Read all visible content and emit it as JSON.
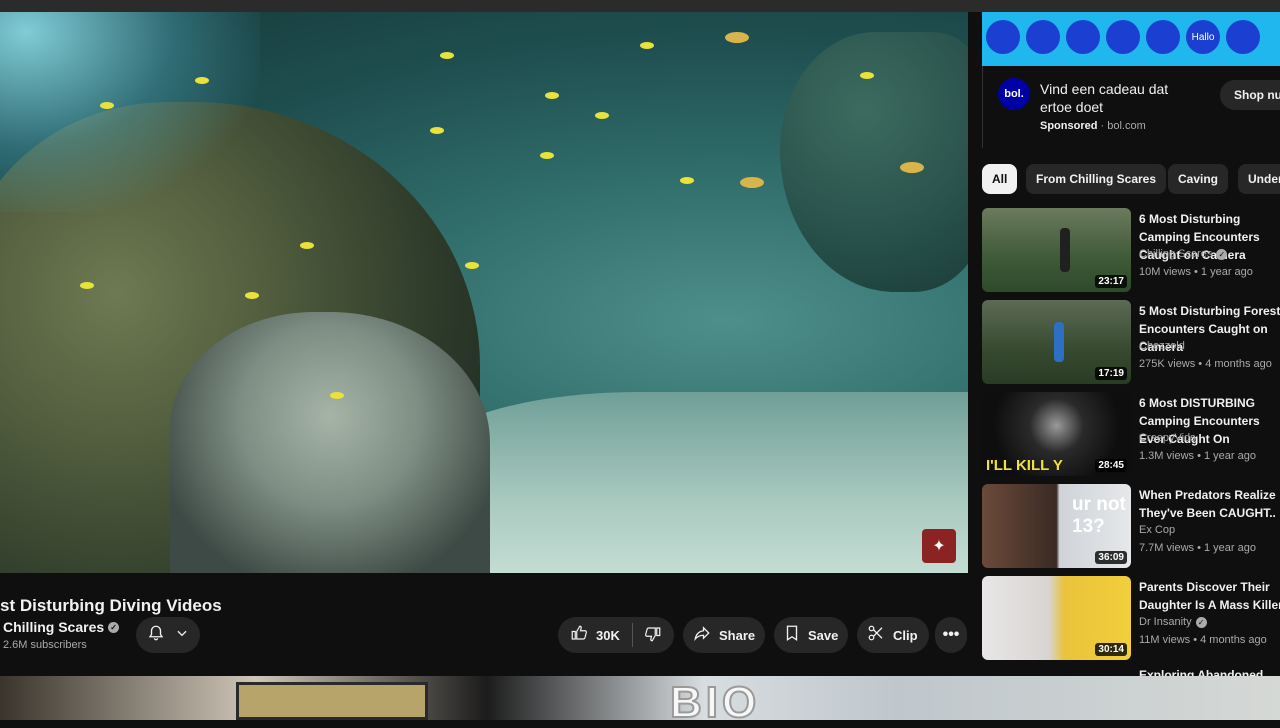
{
  "video": {
    "title": "st Disturbing Diving Videos",
    "channel": "Chilling Scares",
    "subscribers": "2.6M subscribers",
    "likes": "30K",
    "share_label": "Share",
    "save_label": "Save",
    "clip_label": "Clip"
  },
  "ad": {
    "banner_text": "Hallo",
    "logo_text": "bol.",
    "title": "Vind een cadeau dat ertoe doet",
    "sponsored": "Sponsored",
    "domain": "bol.com",
    "cta": "Shop nu"
  },
  "chips": [
    "All",
    "From Chilling Scares",
    "Caving",
    "Under"
  ],
  "recommendations": [
    {
      "title": "6 Most Disturbing Camping Encounters Caught on Camera",
      "channel": "Chilling Scares",
      "verified": true,
      "meta": "10M views • 1 year ago",
      "duration": "23:17"
    },
    {
      "title": "5 Most Disturbing Forest Encounters Caught on Camera",
      "channel": "Chezzold",
      "verified": false,
      "meta": "275K views • 4 months ago",
      "duration": "17:19"
    },
    {
      "title": "6 Most DISTURBING Camping Encounters Ever Caught On",
      "channel": "CreepyVids",
      "verified": false,
      "meta": "1.3M views • 1 year ago",
      "duration": "28:45",
      "overlay": "I'LL KILL Y"
    },
    {
      "title": "When Predators Realize They've Been CAUGHT..",
      "channel": "Ex Cop",
      "verified": false,
      "meta": "7.7M views • 1 year ago",
      "duration": "36:09",
      "overlay": "ur not 13?"
    },
    {
      "title": "Parents Discover Their Daughter Is A Mass Killer",
      "channel": "Dr Insanity",
      "verified": true,
      "meta": "11M views • 4 months ago",
      "duration": "30:14"
    },
    {
      "title": "Exploring Abandoned Hos",
      "channel": "",
      "verified": false,
      "meta": "",
      "duration": ""
    }
  ],
  "bottom": {
    "logo_text": "BIO"
  }
}
